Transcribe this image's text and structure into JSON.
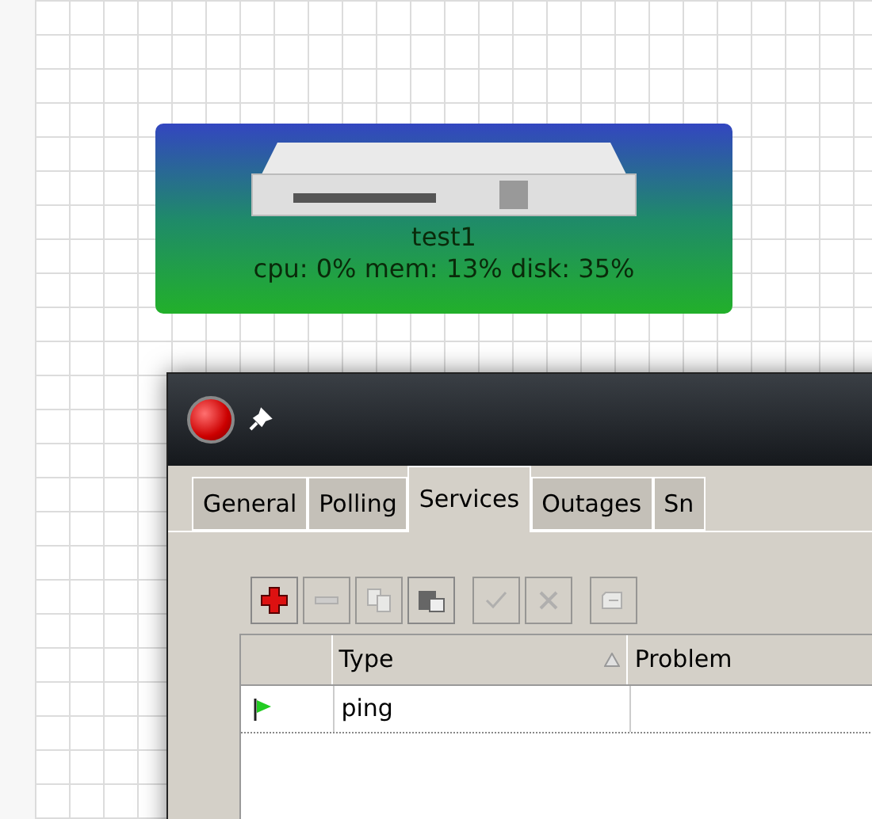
{
  "node": {
    "name": "test1",
    "stats": "cpu: 0% mem: 13% disk: 35%"
  },
  "window": {
    "tabs": [
      {
        "label": "General",
        "selected": false
      },
      {
        "label": "Polling",
        "selected": false
      },
      {
        "label": "Services",
        "selected": true
      },
      {
        "label": "Outages",
        "selected": false
      },
      {
        "label": "Sn",
        "selected": false
      }
    ],
    "toolbar": [
      {
        "kind": "add",
        "disabled": false
      },
      {
        "kind": "remove",
        "disabled": true
      },
      {
        "kind": "copy",
        "disabled": true
      },
      {
        "kind": "paste",
        "disabled": false
      },
      {
        "kind": "enable",
        "disabled": true
      },
      {
        "kind": "disable",
        "disabled": true
      },
      {
        "kind": "comment",
        "disabled": true
      }
    ],
    "table": {
      "columns": [
        {
          "label": "Type",
          "sorted": true
        },
        {
          "label": "Problem",
          "sorted": false
        }
      ],
      "rows": [
        {
          "color": "#22cc22",
          "type": "ping"
        }
      ]
    }
  }
}
